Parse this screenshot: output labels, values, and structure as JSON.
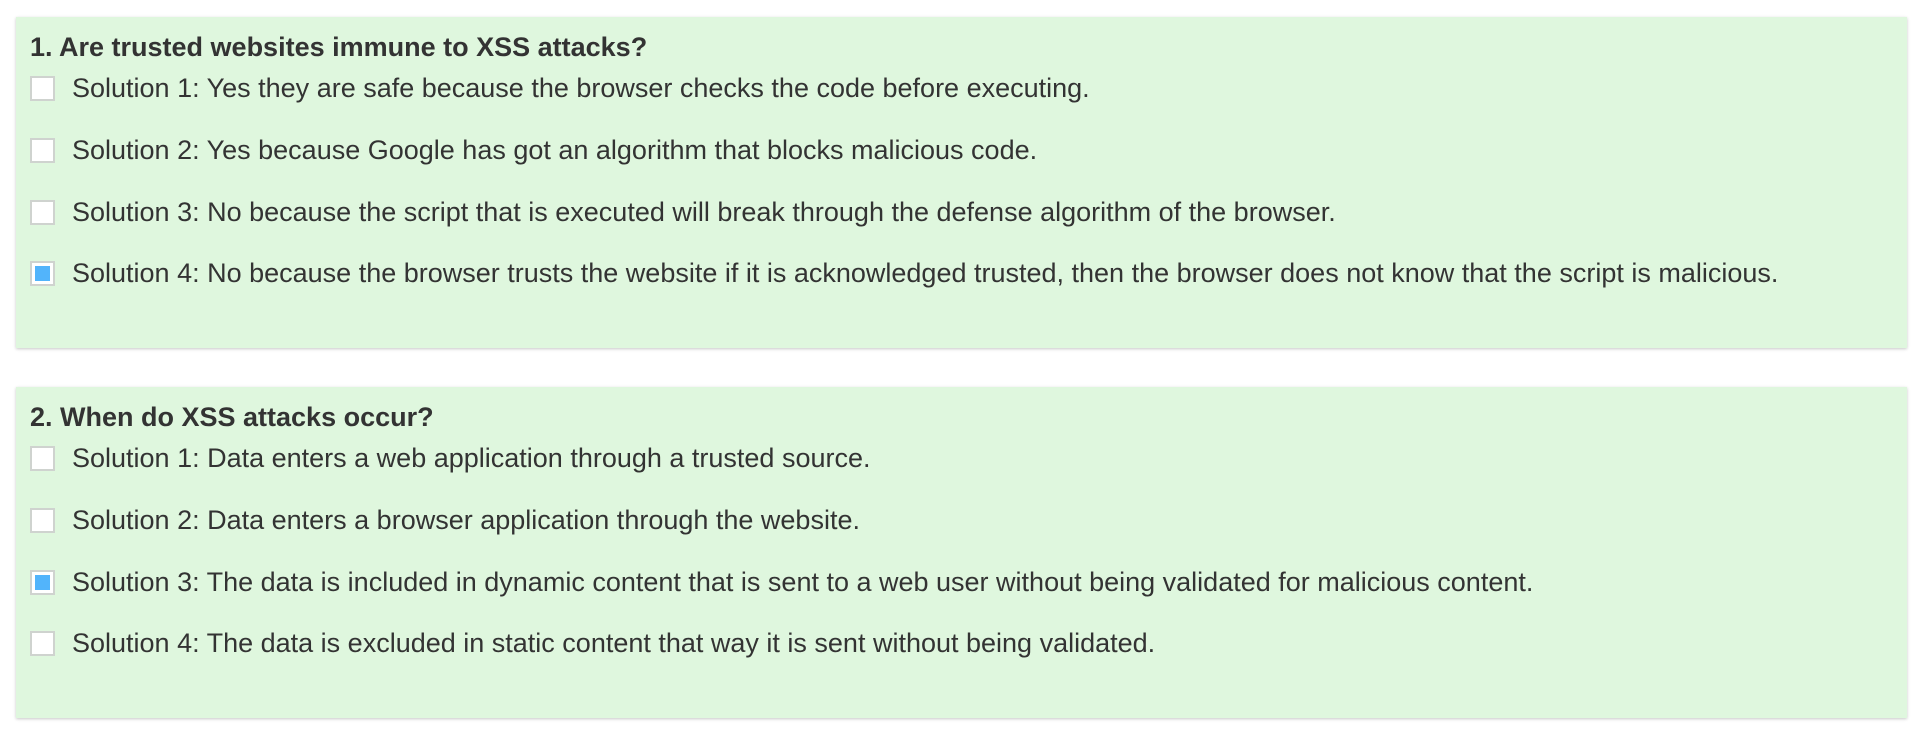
{
  "questions": [
    {
      "title": "1. Are trusted websites immune to XSS attacks?",
      "options": [
        {
          "label": "Solution 1: Yes they are safe because the browser checks the code before executing.",
          "checked": false
        },
        {
          "label": "Solution 2: Yes because Google has got an algorithm that blocks malicious code.",
          "checked": false
        },
        {
          "label": "Solution 3: No because the script that is executed will break through the defense algorithm of the browser.",
          "checked": false
        },
        {
          "label": "Solution 4: No because the browser trusts the website if it is acknowledged trusted, then the browser does not know that the script is malicious.",
          "checked": true
        }
      ]
    },
    {
      "title": "2. When do XSS attacks occur?",
      "options": [
        {
          "label": "Solution 1: Data enters a web application through a trusted source.",
          "checked": false
        },
        {
          "label": "Solution 2: Data enters a browser application through the website.",
          "checked": false
        },
        {
          "label": "Solution 3: The data is included in dynamic content that is sent to a web user without being validated for malicious content.",
          "checked": true
        },
        {
          "label": "Solution 4: The data is excluded in static content that way it is sent without being validated.",
          "checked": false
        }
      ]
    }
  ],
  "colors": {
    "card_background": "#dff7de",
    "checkbox_fill": "#52b4fb",
    "checkbox_border": "#cfd3cf",
    "text": "#333333"
  }
}
